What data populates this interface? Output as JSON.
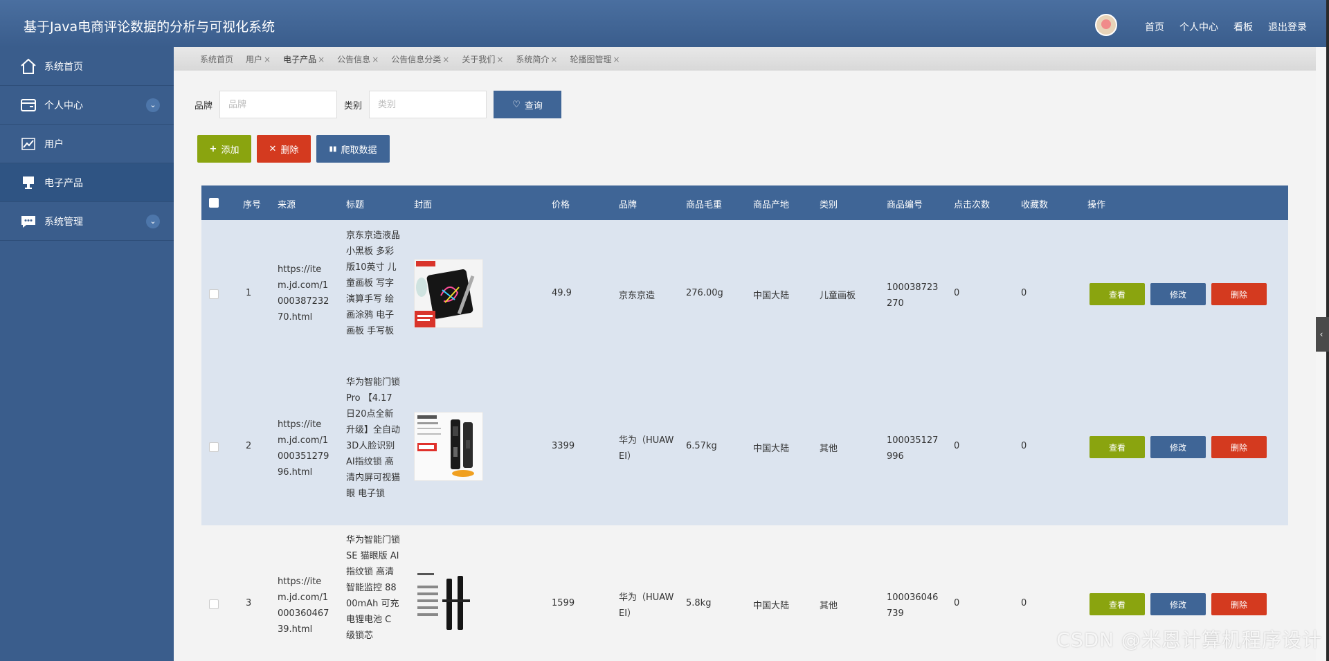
{
  "header": {
    "title": "基于Java电商评论数据的分析与可视化系统",
    "links": [
      "首页",
      "个人中心",
      "看板",
      "退出登录"
    ]
  },
  "sidebar": {
    "items": [
      {
        "label": "系统首页",
        "icon": "home-icon"
      },
      {
        "label": "个人中心",
        "icon": "card-icon"
      },
      {
        "label": "用户",
        "icon": "chart-icon"
      },
      {
        "label": "电子产品",
        "icon": "monitor-icon"
      },
      {
        "label": "系统管理",
        "icon": "chat-icon"
      }
    ]
  },
  "tabs": [
    "系统首页",
    "用户",
    "电子产品",
    "公告信息",
    "公告信息分类",
    "关于我们",
    "系统简介",
    "轮播图管理"
  ],
  "search": {
    "brand_label": "品牌",
    "brand_placeholder": "品牌",
    "category_label": "类别",
    "category_placeholder": "类别",
    "query_label": "查询"
  },
  "actions": {
    "add": "添加",
    "delete": "删除",
    "crawl": "爬取数据"
  },
  "table": {
    "columns": [
      "序号",
      "来源",
      "标题",
      "封面",
      "价格",
      "品牌",
      "商品毛重",
      "商品产地",
      "类别",
      "商品编号",
      "点击次数",
      "收藏数",
      "操作"
    ],
    "rows": [
      {
        "index": "1",
        "source": "https://item.jd.com/100038723270.html",
        "title": "京东京造液晶小黑板 多彩版10英寸 儿童画板 写字演算手写 绘画涂鸦 电子画板 手写板",
        "price": "49.9",
        "brand": "京东京造",
        "weight": "276.00g",
        "origin": "中国大陆",
        "category": "儿童画板",
        "sku": "100038723270",
        "clicks": "0",
        "favorites": "0"
      },
      {
        "index": "2",
        "source": "https://item.jd.com/100035127996.html",
        "title": "华为智能门锁Pro 【4.17日20点全新升级】全自动3D人脸识别 AI指纹锁 高清内屏可视猫眼 电子锁",
        "price": "3399",
        "brand": "华为（HUAWEI）",
        "weight": "6.57kg",
        "origin": "中国大陆",
        "category": "其他",
        "sku": "100035127996",
        "clicks": "0",
        "favorites": "0"
      },
      {
        "index": "3",
        "source": "https://item.jd.com/100036046739.html",
        "title": "华为智能门锁SE 猫眼版 AI指纹锁 高清智能监控 8800mAh 可充电锂电池 C级锁芯",
        "price": "1599",
        "brand": "华为（HUAWEI）",
        "weight": "5.8kg",
        "origin": "中国大陆",
        "category": "其他",
        "sku": "100036046739",
        "clicks": "0",
        "favorites": "0"
      }
    ],
    "row_actions": {
      "view": "查看",
      "edit": "修改",
      "delete": "删除"
    }
  },
  "watermark": "CSDN @米恩计算机程序设计",
  "colors": {
    "primary": "#3f6596",
    "success": "#8aa40f",
    "danger": "#d43a1f",
    "header": "#3a5d8c"
  }
}
